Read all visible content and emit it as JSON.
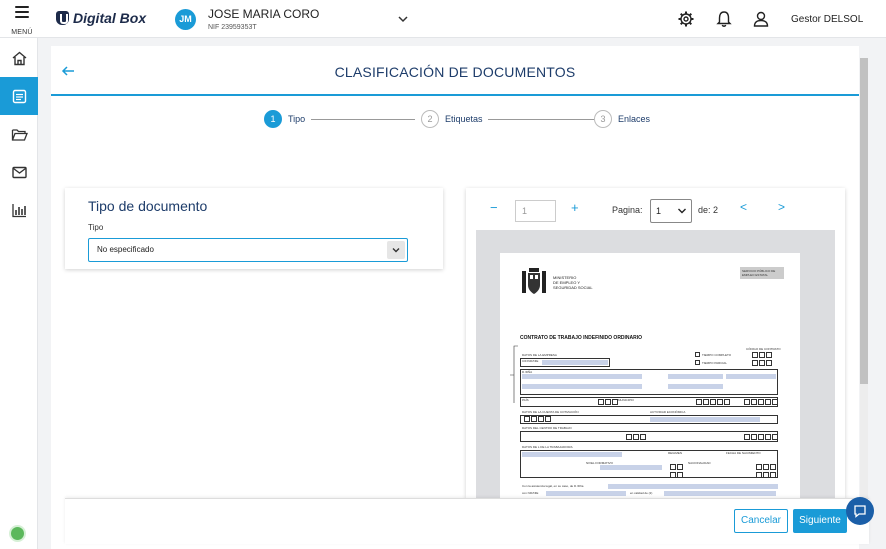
{
  "topbar": {
    "menu_label": "MENÚ",
    "brand": "Digital Box",
    "avatar_initials": "JM",
    "company_name": "JOSE MARIA CORO",
    "company_nif": "NIF 23959353T",
    "user_label": "Gestor DELSOL"
  },
  "colors": {
    "accent": "#1a9bd7",
    "title": "#1d3c6a",
    "chat": "#1b5fa8",
    "help": "#5cb85c"
  },
  "sidebar": {
    "items": [
      {
        "icon": "home-icon"
      },
      {
        "icon": "documents-icon",
        "active": true
      },
      {
        "icon": "folder-icon"
      },
      {
        "icon": "mail-icon"
      },
      {
        "icon": "bar-chart-icon"
      }
    ]
  },
  "page": {
    "title": "CLASIFICACIÓN DE DOCUMENTOS"
  },
  "steps": [
    {
      "num": "1",
      "label": "Tipo",
      "active": true
    },
    {
      "num": "2",
      "label": "Etiquetas",
      "active": false
    },
    {
      "num": "3",
      "label": "Enlaces",
      "active": false
    }
  ],
  "type_panel": {
    "title": "Tipo de documento",
    "field_label": "Tipo",
    "selected": "No especificado"
  },
  "viewer": {
    "zoom_out": "−",
    "zoom_value": "1",
    "zoom_in": "+",
    "page_label": "Pagina:",
    "page_selected": "1",
    "total_label": "de: 2",
    "prev": "<",
    "next": ">"
  },
  "document": {
    "ministry": [
      "MINISTERIO",
      "DE EMPLEO Y",
      "SEGURIDAD SOCIAL"
    ],
    "sepe": "SERVICIO PÚBLICO DE EMPLEO ESTATAL",
    "title": "CONTRATO DE TRABAJO INDEFINIDO ORDINARIO",
    "section_empresa": "DATOS DE LA EMPRESA",
    "section_cotizacion": "DATOS DE LA CUENTA DE COTIZACIÓN",
    "section_centro": "DATOS DEL CENTRO DE TRABAJO",
    "section_trabajador": "DATOS DE L DE LA TRABAJADOR/A",
    "codigo_contrato": "CÓDIGO DE CONTRATO",
    "tiempo_completo": "TIEMPO COMPLETO",
    "tiempo_parcial": "TIEMPO PARCIAL",
    "cif": "CIF/NIF/NIE",
    "nombre": "D./DÑA",
    "actividad": "ACTIVIDAD ECONÓMICA",
    "pais": "PAÍS",
    "municipio": "MUNICIPIO",
    "regimen": "REGIMEN",
    "nivel_formativo": "NIVEL FORMATIVO",
    "nacionalidad": "NACIONALIDAD",
    "fecha_nacimiento": "FECHA DE NACIMIENTO",
    "footer_line": "Con la asistencia legal, en su caso, de D./Dña",
    "nif_line": "con NIF/NIE",
    "calidad_line": "en calidad de (2)"
  },
  "actions": {
    "cancel": "Cancelar",
    "next": "Siguiente"
  }
}
